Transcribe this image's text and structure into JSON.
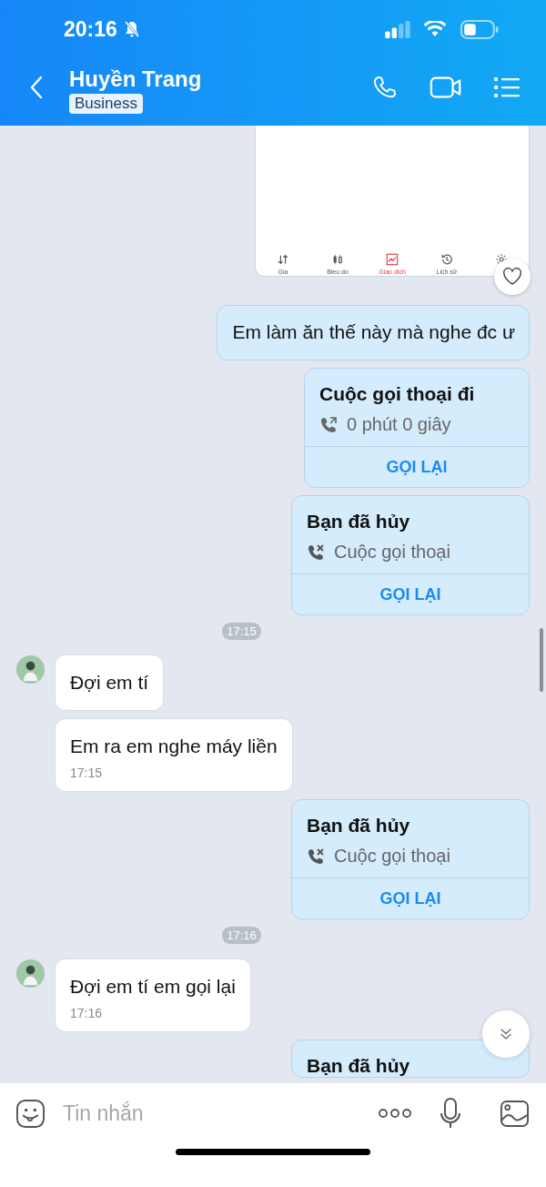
{
  "status_bar": {
    "time": "20:16",
    "muted": true
  },
  "header": {
    "name": "Huyền Trang",
    "badge": "Business"
  },
  "messages": [
    {
      "kind": "image",
      "tabs": [
        {
          "label": "Gia",
          "selected": false
        },
        {
          "label": "Bieu do",
          "selected": false
        },
        {
          "label": "Giao dich",
          "selected": true
        },
        {
          "label": "Lich sử",
          "selected": false
        },
        {
          "selected": false
        }
      ]
    },
    {
      "kind": "text_out",
      "text": "Em làm ăn thế này mà nghe đc ư"
    },
    {
      "kind": "call_outgoing",
      "title": "Cuộc gọi thoại đi",
      "detail": "0 phút 0 giây",
      "action": "GỌI LẠI"
    },
    {
      "kind": "call_cancelled",
      "title": "Bạn đã hủy",
      "detail": "Cuộc gọi thoại",
      "action": "GỌI LẠI"
    },
    {
      "kind": "time",
      "text": "17:15"
    },
    {
      "kind": "text_in",
      "avatar": true,
      "text": "Đợi em tí"
    },
    {
      "kind": "text_in",
      "avatar": false,
      "text": "Em ra em nghe máy liền",
      "time": "17:15"
    },
    {
      "kind": "call_cancelled",
      "title": "Bạn đã hủy",
      "detail": "Cuộc gọi thoại",
      "action": "GỌI LẠI"
    },
    {
      "kind": "time",
      "text": "17:16"
    },
    {
      "kind": "text_in",
      "avatar": true,
      "text": "Đợi em tí em gọi lại",
      "time": "17:16"
    },
    {
      "kind": "call_cancelled",
      "title": "Bạn đã hủy"
    }
  ],
  "composer": {
    "placeholder": "Tin nhắn"
  }
}
